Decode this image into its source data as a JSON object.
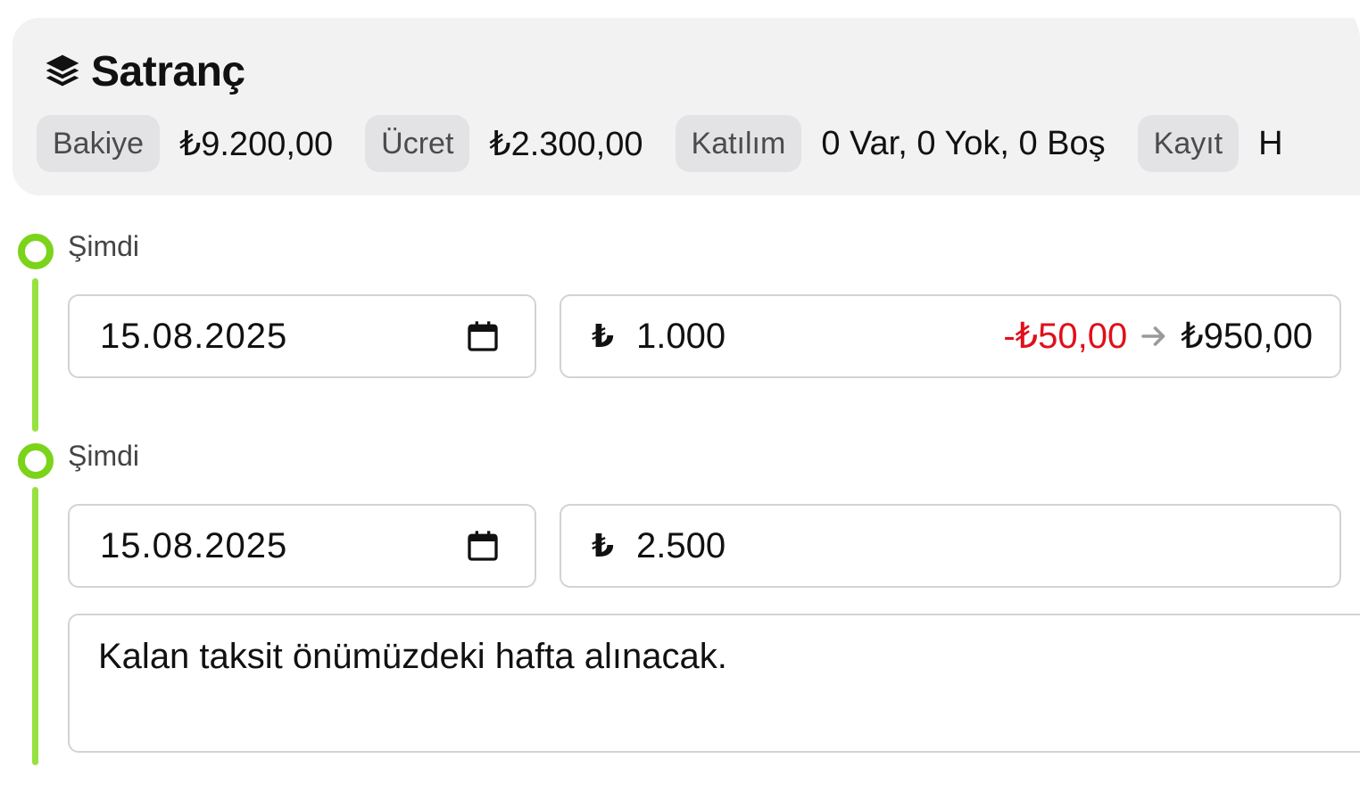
{
  "header": {
    "title": "Satranç",
    "icon": "stack-layers-icon",
    "stats": [
      {
        "label": "Bakiye",
        "value": "₺9.200,00"
      },
      {
        "label": "Ücret",
        "value": "₺2.300,00"
      },
      {
        "label": "Katılım",
        "value": "0 Var, 0 Yok, 0 Boş"
      },
      {
        "label": "Kayıt",
        "value": "H"
      }
    ]
  },
  "timeline": [
    {
      "label": "Şimdi",
      "date": "15.08.2025",
      "currency_symbol": "₺",
      "amount": "1.000",
      "discount": "-₺50,00",
      "net": "₺950,00"
    },
    {
      "label": "Şimdi",
      "date": "15.08.2025",
      "currency_symbol": "₺",
      "amount": "2.500",
      "note": "Kalan taksit önümüzdeki hafta alınacak."
    }
  ],
  "colors": {
    "accent_green": "#7bd31a",
    "discount_red": "#e0101a"
  }
}
